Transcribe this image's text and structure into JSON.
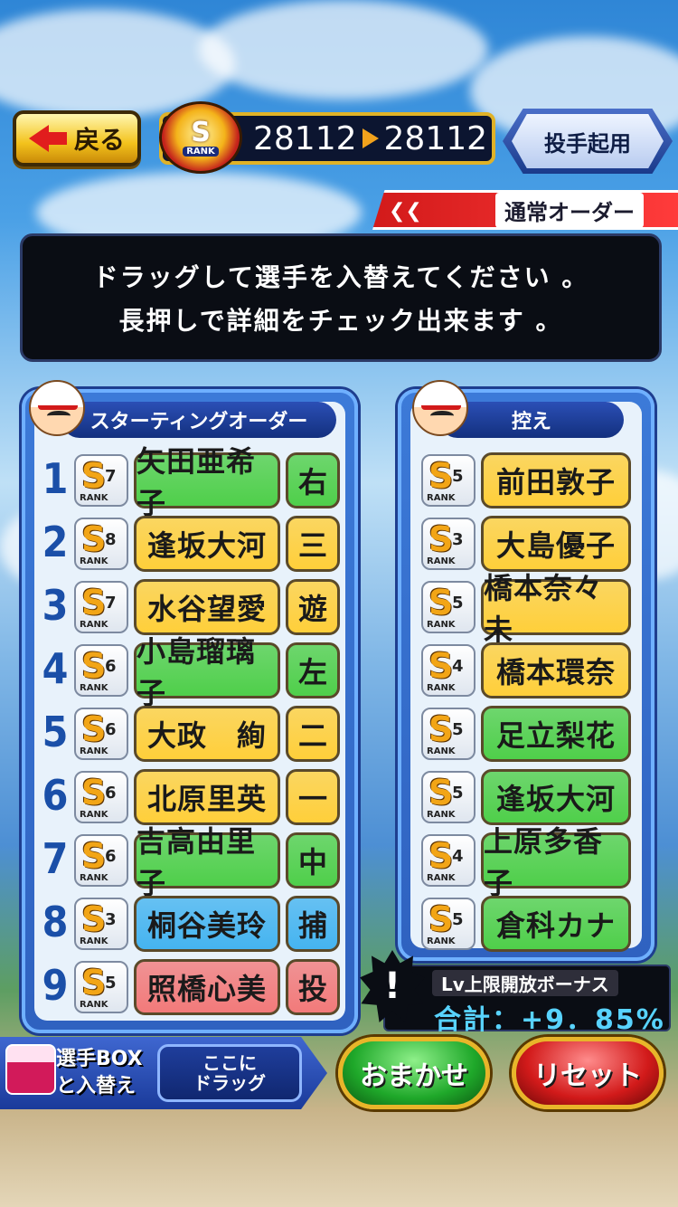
{
  "top": {
    "back_label": "戻る",
    "rank_label": "RANK",
    "rank_letter": "S",
    "score_current": "28112",
    "score_next": "28112",
    "pitcher_button": "投手起用"
  },
  "order_tab": {
    "label": "通常オーダー"
  },
  "message": {
    "line1": "ドラッグして選手を入替えてください 。",
    "line2": "長押しで詳細をチェック出来ます 。"
  },
  "starting": {
    "title": "スターティングオーダー",
    "players": [
      {
        "order": "1",
        "rank": "S",
        "level": "7",
        "name": "矢田亜希子",
        "name_color": "#4fcf4a",
        "position": "右",
        "pos_color": "#4fcf4a"
      },
      {
        "order": "2",
        "rank": "S",
        "level": "8",
        "name": "逢坂大河",
        "name_color": "#ffcf3a",
        "position": "三",
        "pos_color": "#ffcf3a"
      },
      {
        "order": "3",
        "rank": "S",
        "level": "7",
        "name": "水谷望愛",
        "name_color": "#ffcf3a",
        "position": "遊",
        "pos_color": "#ffcf3a"
      },
      {
        "order": "4",
        "rank": "S",
        "level": "6",
        "name": "小島瑠璃子",
        "name_color": "#4fcf4a",
        "position": "左",
        "pos_color": "#4fcf4a"
      },
      {
        "order": "5",
        "rank": "S",
        "level": "6",
        "name": "大政　絢",
        "name_color": "#ffcf3a",
        "position": "二",
        "pos_color": "#ffcf3a"
      },
      {
        "order": "6",
        "rank": "S",
        "level": "6",
        "name": "北原里英",
        "name_color": "#ffcf3a",
        "position": "一",
        "pos_color": "#ffcf3a"
      },
      {
        "order": "7",
        "rank": "S",
        "level": "6",
        "name": "吉高由里子",
        "name_color": "#4fcf4a",
        "position": "中",
        "pos_color": "#4fcf4a"
      },
      {
        "order": "8",
        "rank": "S",
        "level": "3",
        "name": "桐谷美玲",
        "name_color": "#45b4f0",
        "position": "捕",
        "pos_color": "#45b4f0"
      },
      {
        "order": "9",
        "rank": "S",
        "level": "5",
        "name": "照橋心美",
        "name_color": "#f27a7a",
        "position": "投",
        "pos_color": "#f27a7a"
      }
    ]
  },
  "bench": {
    "title": "控え",
    "players": [
      {
        "rank": "S",
        "level": "5",
        "name": "前田敦子",
        "name_color": "#ffcf3a"
      },
      {
        "rank": "S",
        "level": "3",
        "name": "大島優子",
        "name_color": "#ffcf3a"
      },
      {
        "rank": "S",
        "level": "5",
        "name": "橋本奈々未",
        "name_color": "#ffcf3a"
      },
      {
        "rank": "S",
        "level": "4",
        "name": "橋本環奈",
        "name_color": "#ffcf3a"
      },
      {
        "rank": "S",
        "level": "5",
        "name": "足立梨花",
        "name_color": "#4fcf4a"
      },
      {
        "rank": "S",
        "level": "5",
        "name": "逢坂大河",
        "name_color": "#4fcf4a"
      },
      {
        "rank": "S",
        "level": "4",
        "name": "上原多香子",
        "name_color": "#4fcf4a"
      },
      {
        "rank": "S",
        "level": "5",
        "name": "倉科カナ",
        "name_color": "#4fcf4a"
      }
    ]
  },
  "bonus": {
    "mark": "!",
    "title": "Lv上限開放ボーナス",
    "value": "合計：+9．85%"
  },
  "bottom": {
    "box_label1": "選手BOX",
    "box_label2": "と入替え",
    "drop_line1": "ここに",
    "drop_line2": "ドラッグ",
    "auto_button": "おまかせ",
    "reset_button": "リセット"
  },
  "colors": {
    "auto_button": "#1fa82a",
    "reset_button": "#d21a1a"
  }
}
